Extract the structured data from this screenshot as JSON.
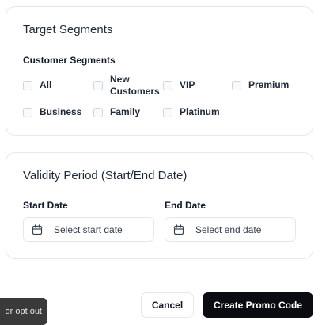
{
  "target_segments": {
    "title": "Target Segments",
    "label": "Customer Segments",
    "options": [
      {
        "label": "All",
        "checked": false
      },
      {
        "label": "New Customers",
        "checked": false
      },
      {
        "label": "VIP",
        "checked": false
      },
      {
        "label": "Premium",
        "checked": false
      },
      {
        "label": "Business",
        "checked": false
      },
      {
        "label": "Family",
        "checked": false
      },
      {
        "label": "Platinum",
        "checked": false
      }
    ]
  },
  "validity": {
    "title": "Validity Period (Start/End Date)",
    "start": {
      "label": "Start Date",
      "placeholder": "Select start date",
      "icon": "calendar-icon"
    },
    "end": {
      "label": "End Date",
      "placeholder": "Select end date",
      "icon": "calendar-icon"
    }
  },
  "actions": {
    "cancel_label": "Cancel",
    "create_label": "Create Promo Code"
  },
  "opt_out": {
    "label": "or opt out"
  },
  "colors": {
    "primary_button": "#0b0b12",
    "border": "#e5e7eb",
    "tooltip_bg": "#3a3a3a"
  }
}
